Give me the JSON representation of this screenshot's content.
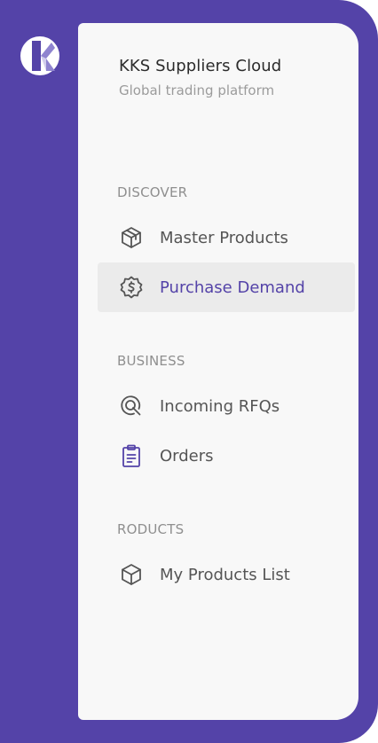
{
  "app": {
    "title": "KKS Suppliers Cloud",
    "subtitle": "Global trading platform"
  },
  "colors": {
    "brand": "#5443a8",
    "panel": "#f8f8f8",
    "active_bg": "#ebebeb",
    "text": "#555555",
    "muted": "#8f8f8f"
  },
  "sections": {
    "discover": "DISCOVER",
    "business": "BUSINESS",
    "products": "RODUCTS"
  },
  "nav": {
    "master_products": {
      "label": "Master Products",
      "icon": "cube-box-icon"
    },
    "purchase_demand": {
      "label": "Purchase Demand",
      "icon": "dollar-badge-icon",
      "active": true
    },
    "incoming_rfqs": {
      "label": "Incoming RFQs",
      "icon": "target-search-icon"
    },
    "orders": {
      "label": "Orders",
      "icon": "clipboard-icon"
    },
    "my_products_list": {
      "label": "My Products List",
      "icon": "box-icon"
    }
  }
}
